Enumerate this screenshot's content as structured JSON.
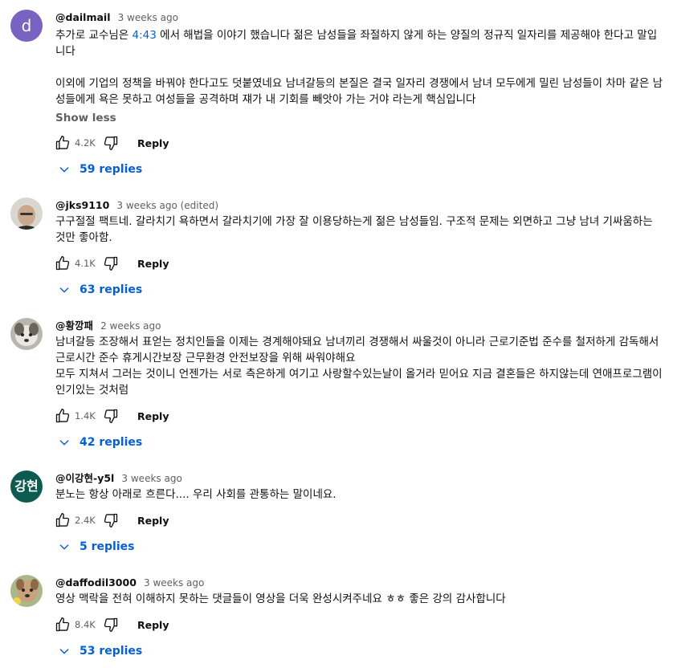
{
  "comments": [
    {
      "author": "@dailmail",
      "meta": "3 weeks ago",
      "avatar_letter": "d",
      "text_before_link": "추가로 교수님은 ",
      "timestamp_link": "4:43",
      "text_after_link": " 에서 해법을 이야기 했습니다 젊은 남성들을 좌절하지 않게 하는 양질의 정규직 일자리를 제공해야 한다고 말입니다",
      "paragraph_2": "이외에 기업의 정책을 바꿔야 한다고도 덧붙였네요 남녀갈등의 본질은 결국 일자리 경쟁에서 남녀 모두에게 밀린 남성들이 차마 같은 남성들에게 욕은 못하고 여성들을 공격하며 쟤가 내 기회를 빼앗아 가는 거야 라는게 핵심입니다",
      "show_less": "Show less",
      "likes": "4.2K",
      "reply_label": "Reply",
      "replies": "59 replies"
    },
    {
      "author": "@jks9110",
      "meta": "3 weeks ago (edited)",
      "text": "구구절절 팩트네. 갈라치기 욕하면서 갈라치기에 가장 잘 이용당하는게 젊은 남성들임. 구조적 문제는 외면하고 그냥 남녀 기싸움하는 것만 좋아함.",
      "likes": "4.1K",
      "reply_label": "Reply",
      "replies": "63 replies"
    },
    {
      "author": "@황깡패",
      "meta": "2 weeks ago",
      "text": "남녀갈등 조장해서 표얻는 정치인들을 이제는 경계해야돼요 남녀끼리 경쟁해서 싸울것이 아니라 근로기준법 준수를 철저하게 감독해서 근로시간 준수 휴게시간보장 근무환경 안전보장을 위해 싸워야해요",
      "text_2": "모두 지쳐서 그러는 것이니 언젠가는 서로 측은하게 여기고 사랑할수있는날이 올거라 믿어요 지금 결혼들은 하지않는데 연애프로그램이 인기있는 것처럼",
      "likes": "1.4K",
      "reply_label": "Reply",
      "replies": "42 replies"
    },
    {
      "author": "@이강현-y5l",
      "meta": "3 weeks ago",
      "avatar_text": "강현",
      "text": "분노는 항상 아래로 흐른다.... 우리 사회를 관통하는 말이네요.",
      "likes": "2.4K",
      "reply_label": "Reply",
      "replies": "5 replies"
    },
    {
      "author": "@daffodil3000",
      "meta": "3 weeks ago",
      "text": "영상 맥락을 전혀 이해하지 못하는 댓글들이 영상을 더욱 완성시켜주네요 ㅎㅎ 좋은 강의 감사합니다",
      "likes": "8.4K",
      "reply_label": "Reply",
      "replies": "53 replies"
    }
  ],
  "icons": {
    "like": "thumbs-up-outline",
    "dislike": "thumbs-down-outline",
    "expand": "chevron-down"
  },
  "colors": {
    "link_blue": "#065fd4",
    "meta_gray": "#606060",
    "avatar_purple": "#7a62c0",
    "avatar_green": "#0d5b50"
  }
}
